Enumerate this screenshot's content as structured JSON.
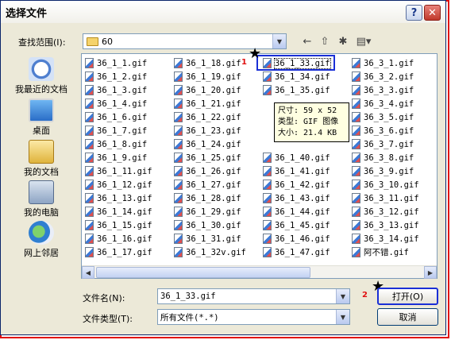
{
  "window": {
    "title": "选择文件",
    "help_label": "?",
    "close_label": "✕"
  },
  "lookin": {
    "label": "查找范围(I):",
    "value": "60"
  },
  "places": [
    {
      "label": "我最近的文档",
      "icon": "recent-documents-icon"
    },
    {
      "label": "桌面",
      "icon": "desktop-icon"
    },
    {
      "label": "我的文档",
      "icon": "my-documents-icon"
    },
    {
      "label": "我的电脑",
      "icon": "my-computer-icon"
    },
    {
      "label": "网上邻居",
      "icon": "network-places-icon"
    }
  ],
  "files": {
    "col1": [
      "36_1_1.gif",
      "36_1_2.gif",
      "36_1_3.gif",
      "36_1_4.gif",
      "36_1_6.gif",
      "36_1_7.gif",
      "36_1_8.gif",
      "36_1_9.gif",
      "36_1_11.gif",
      "36_1_12.gif",
      "36_1_13.gif",
      "36_1_14.gif",
      "36_1_15.gif",
      "36_1_16.gif",
      "36_1_17.gif"
    ],
    "col2": [
      "36_1_18.gif",
      "36_1_19.gif",
      "36_1_20.gif",
      "36_1_21.gif",
      "36_1_22.gif",
      "36_1_23.gif",
      "36_1_24.gif",
      "36_1_25.gif",
      "36_1_26.gif",
      "36_1_27.gif",
      "36_1_28.gif",
      "36_1_29.gif",
      "36_1_30.gif",
      "36_1_31.gif",
      "36_1_32v.gif"
    ],
    "col3": [
      "36_1_33.gif",
      "36_1_34.gif",
      "36_1_35.gif",
      "",
      "",
      "",
      "",
      "36_1_40.gif",
      "36_1_41.gif",
      "36_1_42.gif",
      "36_1_43.gif",
      "36_1_44.gif",
      "36_1_45.gif",
      "36_1_46.gif",
      "36_1_47.gif"
    ],
    "col4": [
      "36_3_1.gif",
      "36_3_2.gif",
      "36_3_3.gif",
      "36_3_4.gif",
      "36_3_5.gif",
      "36_3_6.gif",
      "36_3_7.gif",
      "36_3_8.gif",
      "36_3_9.gif",
      "36_3_10.gif",
      "36_3_11.gif",
      "36_3_12.gif",
      "36_3_13.gif",
      "36_3_14.gif",
      "阿不错.gif"
    ]
  },
  "selected_file": "36_1_33.gif",
  "tooltip": {
    "size": "尺寸: 59 x 52",
    "type": "类型: GIF 图像",
    "filesize": "大小: 21.4 KB"
  },
  "annotations": {
    "marker1": "1",
    "marker2": "2"
  },
  "filename": {
    "label": "文件名(N):",
    "value": "36_1_33.gif"
  },
  "filetype": {
    "label": "文件类型(T):",
    "value": "所有文件(*.*)"
  },
  "buttons": {
    "open": "打开(O)",
    "cancel": "取消"
  },
  "colors": {
    "annotation_red": "#e01010",
    "highlight_blue": "#1a2fd6"
  }
}
